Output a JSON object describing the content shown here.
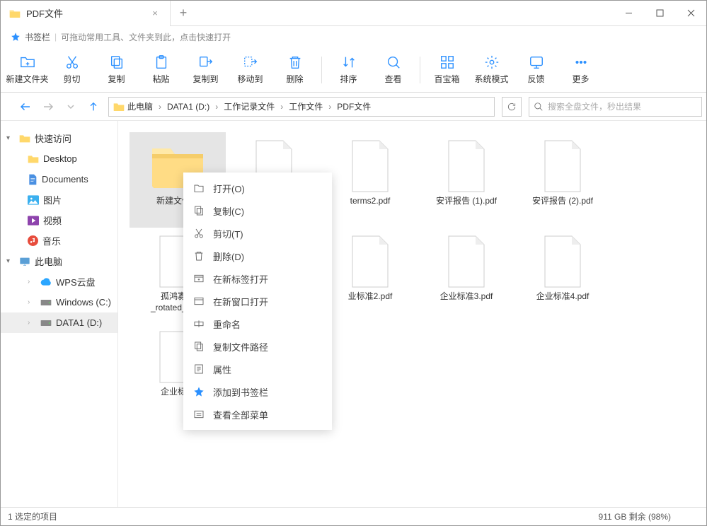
{
  "window": {
    "tab_title": "PDF文件",
    "bookmarks_label": "书签栏",
    "bookmarks_hint": "可拖动常用工具、文件夹到此，点击快速打开"
  },
  "toolbar": {
    "new_folder": "新建文件夹",
    "cut": "剪切",
    "copy": "复制",
    "paste": "粘贴",
    "copy_to": "复制到",
    "move_to": "移动到",
    "delete": "删除",
    "sort": "排序",
    "view": "查看",
    "toolbox": "百宝箱",
    "system_mode": "系统模式",
    "feedback": "反馈",
    "more": "更多"
  },
  "breadcrumbs": [
    "此电脑",
    "DATA1 (D:)",
    "工作记录文件",
    "工作文件",
    "PDF文件"
  ],
  "search_placeholder": "搜索全盘文件，秒出结果",
  "sidebar": {
    "quick_access": "快速访问",
    "desktop": "Desktop",
    "documents": "Documents",
    "pictures": "图片",
    "videos": "视频",
    "music": "音乐",
    "this_pc": "此电脑",
    "wps_cloud": "WPS云盘",
    "windows_c": "Windows (C:)",
    "data1_d": "DATA1 (D:)"
  },
  "files": {
    "row1": [
      {
        "name": "新建文件夹",
        "type": "folder"
      },
      {
        "name": "",
        "type": "pdf"
      },
      {
        "name": "terms2.pdf",
        "type": "pdf"
      },
      {
        "name": "安评报告 (1).pdf",
        "type": "pdf"
      },
      {
        "name": "安评报告 (2).pdf",
        "type": "pdf"
      }
    ],
    "row2": [
      {
        "name": "孤鸿寡鹄_rotated_NoWatermark.pdf",
        "type": "pdf",
        "display": "孤鸿寡鹄\n_rotated_NoWatermark"
      },
      {
        "name": "",
        "type": "pdf"
      },
      {
        "name": "业标准2.pdf",
        "type": "pdf"
      },
      {
        "name": "企业标准3.pdf",
        "type": "pdf"
      },
      {
        "name": "企业标准4.pdf",
        "type": "pdf"
      }
    ],
    "row3": [
      {
        "name": "企业标准",
        "type": "pdf"
      }
    ]
  },
  "context_menu": {
    "open": "打开(O)",
    "copy": "复制(C)",
    "cut": "剪切(T)",
    "delete": "删除(D)",
    "open_new_tab": "在新标签打开",
    "open_new_window": "在新窗口打开",
    "rename": "重命名",
    "copy_path": "复制文件路径",
    "properties": "属性",
    "add_bookmark": "添加到书签栏",
    "view_all": "查看全部菜单"
  },
  "status": {
    "selection": "1 选定的项目",
    "disk": "911 GB 剩余 (98%)"
  }
}
